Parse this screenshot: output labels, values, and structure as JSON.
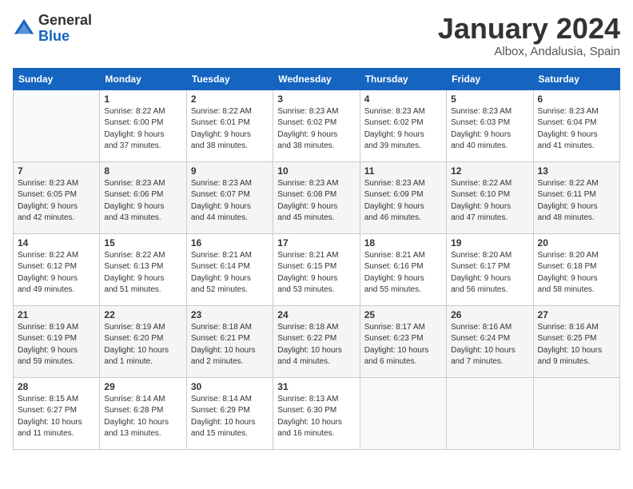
{
  "header": {
    "logo_general": "General",
    "logo_blue": "Blue",
    "month": "January 2024",
    "location": "Albox, Andalusia, Spain"
  },
  "days_of_week": [
    "Sunday",
    "Monday",
    "Tuesday",
    "Wednesday",
    "Thursday",
    "Friday",
    "Saturday"
  ],
  "weeks": [
    [
      {
        "day": "",
        "info": ""
      },
      {
        "day": "1",
        "info": "Sunrise: 8:22 AM\nSunset: 6:00 PM\nDaylight: 9 hours\nand 37 minutes."
      },
      {
        "day": "2",
        "info": "Sunrise: 8:22 AM\nSunset: 6:01 PM\nDaylight: 9 hours\nand 38 minutes."
      },
      {
        "day": "3",
        "info": "Sunrise: 8:23 AM\nSunset: 6:02 PM\nDaylight: 9 hours\nand 38 minutes."
      },
      {
        "day": "4",
        "info": "Sunrise: 8:23 AM\nSunset: 6:02 PM\nDaylight: 9 hours\nand 39 minutes."
      },
      {
        "day": "5",
        "info": "Sunrise: 8:23 AM\nSunset: 6:03 PM\nDaylight: 9 hours\nand 40 minutes."
      },
      {
        "day": "6",
        "info": "Sunrise: 8:23 AM\nSunset: 6:04 PM\nDaylight: 9 hours\nand 41 minutes."
      }
    ],
    [
      {
        "day": "7",
        "info": "Sunrise: 8:23 AM\nSunset: 6:05 PM\nDaylight: 9 hours\nand 42 minutes."
      },
      {
        "day": "8",
        "info": "Sunrise: 8:23 AM\nSunset: 6:06 PM\nDaylight: 9 hours\nand 43 minutes."
      },
      {
        "day": "9",
        "info": "Sunrise: 8:23 AM\nSunset: 6:07 PM\nDaylight: 9 hours\nand 44 minutes."
      },
      {
        "day": "10",
        "info": "Sunrise: 8:23 AM\nSunset: 6:08 PM\nDaylight: 9 hours\nand 45 minutes."
      },
      {
        "day": "11",
        "info": "Sunrise: 8:23 AM\nSunset: 6:09 PM\nDaylight: 9 hours\nand 46 minutes."
      },
      {
        "day": "12",
        "info": "Sunrise: 8:22 AM\nSunset: 6:10 PM\nDaylight: 9 hours\nand 47 minutes."
      },
      {
        "day": "13",
        "info": "Sunrise: 8:22 AM\nSunset: 6:11 PM\nDaylight: 9 hours\nand 48 minutes."
      }
    ],
    [
      {
        "day": "14",
        "info": "Sunrise: 8:22 AM\nSunset: 6:12 PM\nDaylight: 9 hours\nand 49 minutes."
      },
      {
        "day": "15",
        "info": "Sunrise: 8:22 AM\nSunset: 6:13 PM\nDaylight: 9 hours\nand 51 minutes."
      },
      {
        "day": "16",
        "info": "Sunrise: 8:21 AM\nSunset: 6:14 PM\nDaylight: 9 hours\nand 52 minutes."
      },
      {
        "day": "17",
        "info": "Sunrise: 8:21 AM\nSunset: 6:15 PM\nDaylight: 9 hours\nand 53 minutes."
      },
      {
        "day": "18",
        "info": "Sunrise: 8:21 AM\nSunset: 6:16 PM\nDaylight: 9 hours\nand 55 minutes."
      },
      {
        "day": "19",
        "info": "Sunrise: 8:20 AM\nSunset: 6:17 PM\nDaylight: 9 hours\nand 56 minutes."
      },
      {
        "day": "20",
        "info": "Sunrise: 8:20 AM\nSunset: 6:18 PM\nDaylight: 9 hours\nand 58 minutes."
      }
    ],
    [
      {
        "day": "21",
        "info": "Sunrise: 8:19 AM\nSunset: 6:19 PM\nDaylight: 9 hours\nand 59 minutes."
      },
      {
        "day": "22",
        "info": "Sunrise: 8:19 AM\nSunset: 6:20 PM\nDaylight: 10 hours\nand 1 minute."
      },
      {
        "day": "23",
        "info": "Sunrise: 8:18 AM\nSunset: 6:21 PM\nDaylight: 10 hours\nand 2 minutes."
      },
      {
        "day": "24",
        "info": "Sunrise: 8:18 AM\nSunset: 6:22 PM\nDaylight: 10 hours\nand 4 minutes."
      },
      {
        "day": "25",
        "info": "Sunrise: 8:17 AM\nSunset: 6:23 PM\nDaylight: 10 hours\nand 6 minutes."
      },
      {
        "day": "26",
        "info": "Sunrise: 8:16 AM\nSunset: 6:24 PM\nDaylight: 10 hours\nand 7 minutes."
      },
      {
        "day": "27",
        "info": "Sunrise: 8:16 AM\nSunset: 6:25 PM\nDaylight: 10 hours\nand 9 minutes."
      }
    ],
    [
      {
        "day": "28",
        "info": "Sunrise: 8:15 AM\nSunset: 6:27 PM\nDaylight: 10 hours\nand 11 minutes."
      },
      {
        "day": "29",
        "info": "Sunrise: 8:14 AM\nSunset: 6:28 PM\nDaylight: 10 hours\nand 13 minutes."
      },
      {
        "day": "30",
        "info": "Sunrise: 8:14 AM\nSunset: 6:29 PM\nDaylight: 10 hours\nand 15 minutes."
      },
      {
        "day": "31",
        "info": "Sunrise: 8:13 AM\nSunset: 6:30 PM\nDaylight: 10 hours\nand 16 minutes."
      },
      {
        "day": "",
        "info": ""
      },
      {
        "day": "",
        "info": ""
      },
      {
        "day": "",
        "info": ""
      }
    ]
  ]
}
